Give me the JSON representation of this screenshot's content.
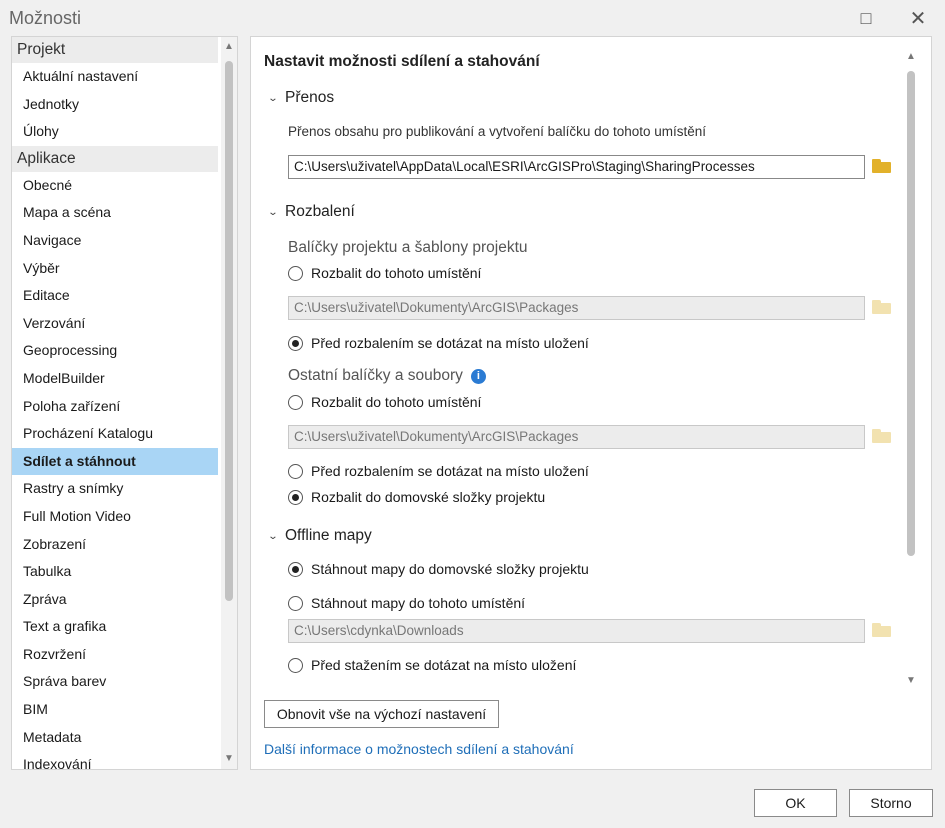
{
  "window": {
    "title": "Možnosti",
    "maximize_icon": "□",
    "close_icon": "✕"
  },
  "nav": {
    "groups": [
      {
        "label": "Projekt",
        "items": [
          "Aktuální nastavení",
          "Jednotky",
          "Úlohy"
        ]
      },
      {
        "label": "Aplikace",
        "items": [
          "Obecné",
          "Mapa a scéna",
          "Navigace",
          "Výběr",
          "Editace",
          "Verzování",
          "Geoprocessing",
          "ModelBuilder",
          "Poloha zařízení",
          "Procházení Katalogu",
          "Sdílet a stáhnout",
          "Rastry a snímky",
          "Full Motion Video",
          "Zobrazení",
          "Tabulka",
          "Zpráva",
          "Text a grafika",
          "Rozvržení",
          "Správa barev",
          "BIM",
          "Metadata",
          "Indexování"
        ]
      }
    ],
    "selected": "Sdílet a stáhnout",
    "scroll_up_icon": "▲",
    "scroll_down_icon": "▼"
  },
  "panel": {
    "heading": "Nastavit možnosti sdílení a stahování",
    "chevron_icon": "⌄",
    "transfer": {
      "title": "Přenos",
      "description": "Přenos obsahu pro publikování a vytvoření balíčku do tohoto umístění",
      "path": "C:\\Users\\uživatel\\AppData\\Local\\ESRI\\ArcGISPro\\Staging\\SharingProcesses"
    },
    "unpack": {
      "title": "Rozbalení",
      "project_packages": {
        "label": "Balíčky projektu a šablony projektu",
        "option_here": "Rozbalit do tohoto umístění",
        "path": "C:\\Users\\uživatel\\Dokumenty\\ArcGIS\\Packages",
        "option_ask": "Před rozbalením se dotázat na místo uložení",
        "selected": "ask"
      },
      "other_packages": {
        "label": "Ostatní balíčky a soubory",
        "info_icon": "i",
        "option_here": "Rozbalit do tohoto umístění",
        "path": "C:\\Users\\uživatel\\Dokumenty\\ArcGIS\\Packages",
        "option_ask": "Před rozbalením se dotázat na místo uložení",
        "option_home": "Rozbalit do domovské složky projektu",
        "selected": "home"
      }
    },
    "offline": {
      "title": "Offline mapy",
      "option_home": "Stáhnout mapy do domovské složky projektu",
      "option_here": "Stáhnout mapy do tohoto umístění",
      "path": "C:\\Users\\cdynka\\Downloads",
      "option_ask": "Před stažením se dotázat na místo uložení",
      "selected": "home"
    },
    "reset_label": "Obnovit vše na výchozí nastavení",
    "more_info_link": "Další informace o možnostech sdílení a stahování"
  },
  "footer": {
    "ok_label": "OK",
    "cancel_label": "Storno"
  }
}
